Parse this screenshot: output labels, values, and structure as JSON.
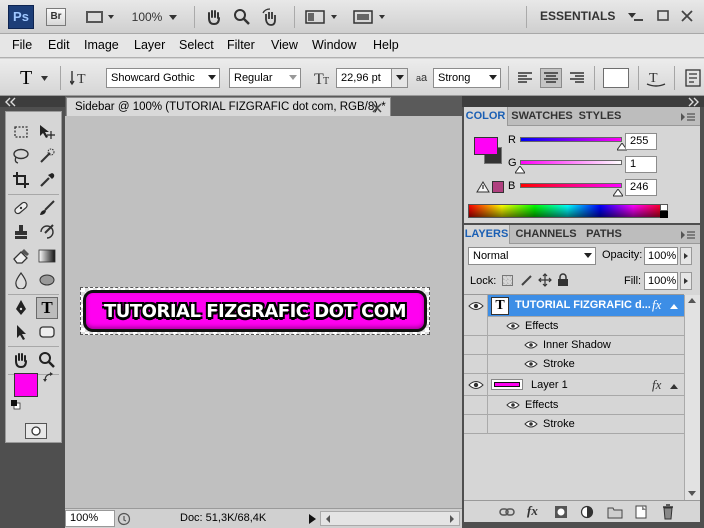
{
  "appbar": {
    "ps": "Ps",
    "br": "Br",
    "zoom": "100%",
    "workspace": "ESSENTIALS"
  },
  "menu": [
    "File",
    "Edit",
    "Image",
    "Layer",
    "Select",
    "Filter",
    "View",
    "Window",
    "Help"
  ],
  "options": {
    "font_family": "Showcard Gothic",
    "font_style": "Regular",
    "font_size": "22,96 pt",
    "aa_label": "a",
    "aa_mode": "Strong"
  },
  "document": {
    "tab_title": "Sidebar @ 100% (TUTORIAL FIZGRAFIC dot com, RGB/8) *",
    "banner_text": "TUTORIAL FIZGRAFIC DOT COM",
    "zoom": "100%",
    "doc_info": "Doc: 51,3K/68,4K"
  },
  "color_panel": {
    "tabs": [
      "COLOR",
      "SWATCHES",
      "STYLES"
    ],
    "r_label": "R",
    "g_label": "G",
    "b_label": "B",
    "r": "255",
    "g": "1",
    "b": "246",
    "r_frac": 1.0,
    "g_frac": 0.004,
    "b_frac": 0.965,
    "fg_color": "#ff01f6"
  },
  "layers_panel": {
    "tabs": [
      "LAYERS",
      "CHANNELS",
      "PATHS"
    ],
    "blend_mode": "Normal",
    "opacity_label": "Opacity:",
    "opacity": "100%",
    "lock_label": "Lock:",
    "fill_label": "Fill:",
    "fill": "100%",
    "layers": [
      {
        "name": "TUTORIAL FIZGRAFIC d...",
        "fx": "fx",
        "effects_label": "Effects",
        "effects": [
          "Inner Shadow",
          "Stroke"
        ]
      },
      {
        "name": "Layer 1",
        "fx": "fx",
        "effects_label": "Effects",
        "effects": [
          "Stroke"
        ]
      }
    ]
  },
  "colors": {
    "accent": "#ff00f0",
    "selected_layer": "#3d8ee6",
    "canvas_bg": "#c0c0c0"
  }
}
